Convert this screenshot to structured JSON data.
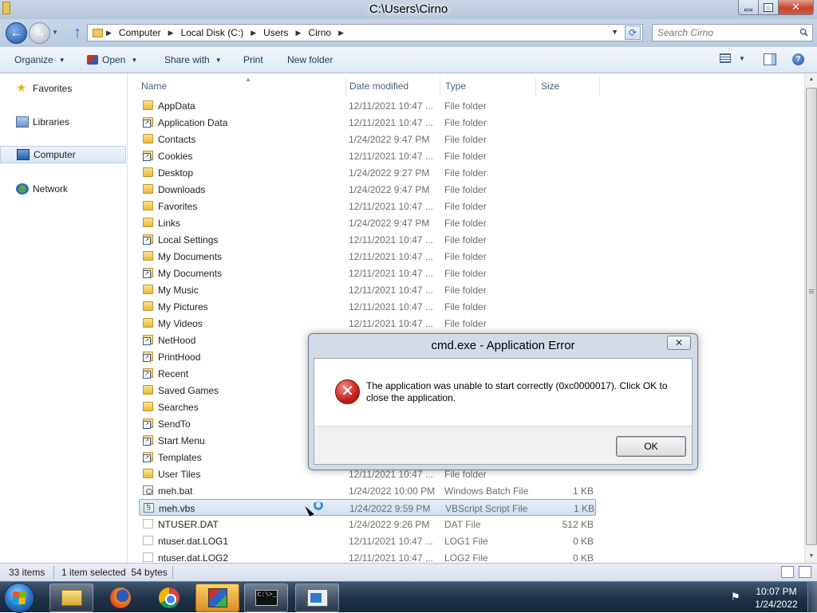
{
  "window": {
    "title": "C:\\Users\\Cirno"
  },
  "address": {
    "breadcrumbs": [
      "Computer",
      "Local Disk (C:)",
      "Users",
      "Cirno"
    ],
    "search_placeholder": "Search Cirno"
  },
  "toolbar": {
    "organize": "Organize",
    "open": "Open",
    "share_with": "Share with",
    "print": "Print",
    "new_folder": "New folder"
  },
  "navigation": {
    "items": [
      {
        "label": "Favorites",
        "icon": "star-icon"
      },
      {
        "label": "Libraries",
        "icon": "library-icon"
      },
      {
        "label": "Computer",
        "icon": "computer-icon",
        "selected": true
      },
      {
        "label": "Network",
        "icon": "network-icon"
      }
    ]
  },
  "columns": [
    "Name",
    "Date modified",
    "Type",
    "Size"
  ],
  "files": [
    {
      "name": "AppData",
      "date": "12/11/2021 10:47 ...",
      "type": "File folder",
      "size": "",
      "icon": "folder-icon"
    },
    {
      "name": "Application Data",
      "date": "12/11/2021 10:47 ...",
      "type": "File folder",
      "size": "",
      "icon": "shortcut-icon"
    },
    {
      "name": "Contacts",
      "date": "1/24/2022 9:47 PM",
      "type": "File folder",
      "size": "",
      "icon": "folder-icon"
    },
    {
      "name": "Cookies",
      "date": "12/11/2021 10:47 ...",
      "type": "File folder",
      "size": "",
      "icon": "shortcut-icon"
    },
    {
      "name": "Desktop",
      "date": "1/24/2022 9:27 PM",
      "type": "File folder",
      "size": "",
      "icon": "folder-icon"
    },
    {
      "name": "Downloads",
      "date": "1/24/2022 9:47 PM",
      "type": "File folder",
      "size": "",
      "icon": "folder-icon"
    },
    {
      "name": "Favorites",
      "date": "12/11/2021 10:47 ...",
      "type": "File folder",
      "size": "",
      "icon": "folder-icon"
    },
    {
      "name": "Links",
      "date": "1/24/2022 9:47 PM",
      "type": "File folder",
      "size": "",
      "icon": "folder-icon"
    },
    {
      "name": "Local Settings",
      "date": "12/11/2021 10:47 ...",
      "type": "File folder",
      "size": "",
      "icon": "shortcut-icon"
    },
    {
      "name": "My Documents",
      "date": "12/11/2021 10:47 ...",
      "type": "File folder",
      "size": "",
      "icon": "folder-icon"
    },
    {
      "name": "My Documents",
      "date": "12/11/2021 10:47 ...",
      "type": "File folder",
      "size": "",
      "icon": "shortcut-icon"
    },
    {
      "name": "My Music",
      "date": "12/11/2021 10:47 ...",
      "type": "File folder",
      "size": "",
      "icon": "folder-icon"
    },
    {
      "name": "My Pictures",
      "date": "12/11/2021 10:47 ...",
      "type": "File folder",
      "size": "",
      "icon": "folder-icon"
    },
    {
      "name": "My Videos",
      "date": "12/11/2021 10:47 ...",
      "type": "File folder",
      "size": "",
      "icon": "folder-icon"
    },
    {
      "name": "NetHood",
      "date": "",
      "type": "",
      "size": "",
      "icon": "shortcut-icon"
    },
    {
      "name": "PrintHood",
      "date": "",
      "type": "",
      "size": "",
      "icon": "shortcut-icon"
    },
    {
      "name": "Recent",
      "date": "",
      "type": "",
      "size": "",
      "icon": "shortcut-icon"
    },
    {
      "name": "Saved Games",
      "date": "",
      "type": "",
      "size": "",
      "icon": "folder-icon"
    },
    {
      "name": "Searches",
      "date": "",
      "type": "",
      "size": "",
      "icon": "folder-icon"
    },
    {
      "name": "SendTo",
      "date": "",
      "type": "",
      "size": "",
      "icon": "shortcut-icon"
    },
    {
      "name": "Start Menu",
      "date": "",
      "type": "",
      "size": "",
      "icon": "shortcut-icon"
    },
    {
      "name": "Templates",
      "date": "",
      "type": "",
      "size": "",
      "icon": "shortcut-icon"
    },
    {
      "name": "User Tiles",
      "date": "12/11/2021 10:47 ...",
      "type": "File folder",
      "size": "",
      "icon": "folder-icon"
    },
    {
      "name": "meh.bat",
      "date": "1/24/2022 10:00 PM",
      "type": "Windows Batch File",
      "size": "1 KB",
      "icon": "batch-file-icon"
    },
    {
      "name": "meh.vbs",
      "date": "1/24/2022 9:59 PM",
      "type": "VBScript Script File",
      "size": "1 KB",
      "icon": "vbscript-file-icon",
      "selected": true
    },
    {
      "name": "NTUSER.DAT",
      "date": "1/24/2022 9:26 PM",
      "type": "DAT File",
      "size": "512 KB",
      "icon": "file-icon"
    },
    {
      "name": "ntuser.dat.LOG1",
      "date": "12/11/2021 10:47 ...",
      "type": "LOG1 File",
      "size": "0 KB",
      "icon": "file-icon"
    },
    {
      "name": "ntuser.dat.LOG2",
      "date": "12/11/2021 10:47 ...",
      "type": "LOG2 File",
      "size": "0 KB",
      "icon": "file-icon"
    }
  ],
  "status": {
    "item_count": "33 items",
    "selection": "1 item selected  54 bytes"
  },
  "dialog": {
    "title": "cmd.exe - Application Error",
    "message": "The application was unable to start correctly (0xc0000017). Click OK to close the application.",
    "ok": "OK"
  },
  "taskbar": {
    "time": "10:07 PM",
    "date": "1/24/2022",
    "cmd_glyph": "C:\\>_"
  }
}
